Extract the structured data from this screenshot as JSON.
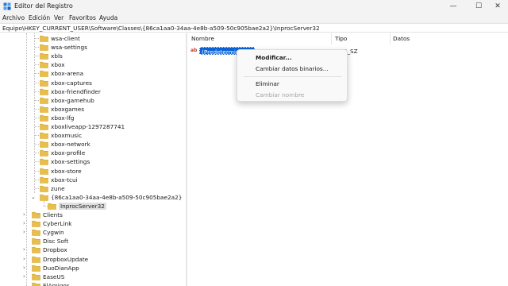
{
  "window": {
    "title": "Editor del Registro",
    "minimize_glyph": "—",
    "maximize_glyph": "☐",
    "close_glyph": "✕"
  },
  "menu": [
    "Archivo",
    "Edición",
    "Ver",
    "Favoritos",
    "Ayuda"
  ],
  "address": "Equipo\\HKEY_CURRENT_USER\\Software\\Classes\\{86ca1aa0-34aa-4e8b-a509-50c905bae2a2}\\InprocServer32",
  "tree": {
    "indented_items": [
      "wsa-client",
      "wsa-settings",
      "xbls",
      "xbox",
      "xbox-arena",
      "xbox-captures",
      "xbox-friendfinder",
      "xbox-gamehub",
      "xboxgames",
      "xbox-lfg",
      "xboxliveapp-1297287741",
      "xboxmusic",
      "xbox-network",
      "xbox-profile",
      "xbox-settings",
      "xbox-store",
      "xbox-tcui",
      "zune"
    ],
    "expanded_key": "{86ca1aa0-34aa-4e8b-a509-50c905bae2a2}",
    "expanded_glyph": "⌄",
    "selected_key": "InprocServer32",
    "collapsed_glyph": "›",
    "root_items": [
      "Clients",
      "CyberLink",
      "Cygwin",
      "Disc Soft",
      "Dropbox",
      "DropboxUpdate",
      "DuoDianApp",
      "EaseUS",
      "ElAmigos"
    ]
  },
  "list": {
    "columns": [
      "Nombre",
      "Tipo",
      "Datos"
    ],
    "rows": [
      {
        "icon": "ab",
        "name": "(Predeterminado)",
        "type": "REG_SZ",
        "data": ""
      }
    ]
  },
  "context_menu": {
    "items": [
      {
        "label": "Modificar...",
        "bold": true,
        "enabled": true
      },
      {
        "label": "Cambiar datos binarios...",
        "bold": false,
        "enabled": true
      },
      {
        "label": "Eliminar",
        "bold": false,
        "enabled": true
      },
      {
        "label": "Cambiar nombre",
        "bold": false,
        "enabled": false
      }
    ]
  },
  "colors": {
    "folder": "#e8bf4c",
    "folder_dark": "#d4a62a",
    "selection": "#0a64d6",
    "title_bar": "#f3f3f3",
    "value_icon": "#c0392b"
  },
  "icons": {
    "app": "regedit-icon",
    "folder": "folder-icon",
    "value": "string-value-icon"
  }
}
